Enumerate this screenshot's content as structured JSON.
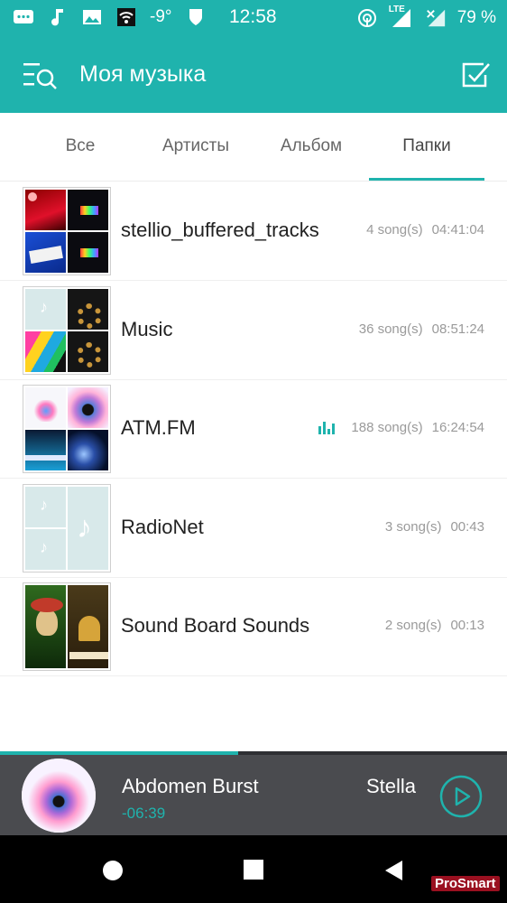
{
  "colors": {
    "accent": "#1fb3ad",
    "player_bg": "#4a4b4f"
  },
  "status_bar": {
    "temperature": "-9°",
    "time": "12:58",
    "network": "LTE",
    "battery": "79 %"
  },
  "app_bar": {
    "title": "Моя музыка",
    "left_icon": "menu-search-icon",
    "right_icon": "select-check-icon"
  },
  "tabs": [
    {
      "label": "Все",
      "selected": false
    },
    {
      "label": "Артисты",
      "selected": false
    },
    {
      "label": "Альбом",
      "selected": false
    },
    {
      "label": "Папки",
      "selected": true
    }
  ],
  "folders": [
    {
      "name": "stellio_buffered_tracks",
      "songs": "4 song(s)",
      "duration": "04:41:04",
      "playing": false
    },
    {
      "name": "Music",
      "songs": "36 song(s)",
      "duration": "08:51:24",
      "playing": false
    },
    {
      "name": "ATM.FM",
      "songs": "188 song(s)",
      "duration": "16:24:54",
      "playing": true
    },
    {
      "name": "RadioNet",
      "songs": "3 song(s)",
      "duration": "00:43",
      "playing": false
    },
    {
      "name": "Sound Board Sounds",
      "songs": "2 song(s)",
      "duration": "00:13",
      "playing": false
    }
  ],
  "player": {
    "title": "Abdomen Burst",
    "artist": "Stella",
    "time": "-06:39",
    "progress": 0.47
  },
  "watermark": "ProSmart"
}
